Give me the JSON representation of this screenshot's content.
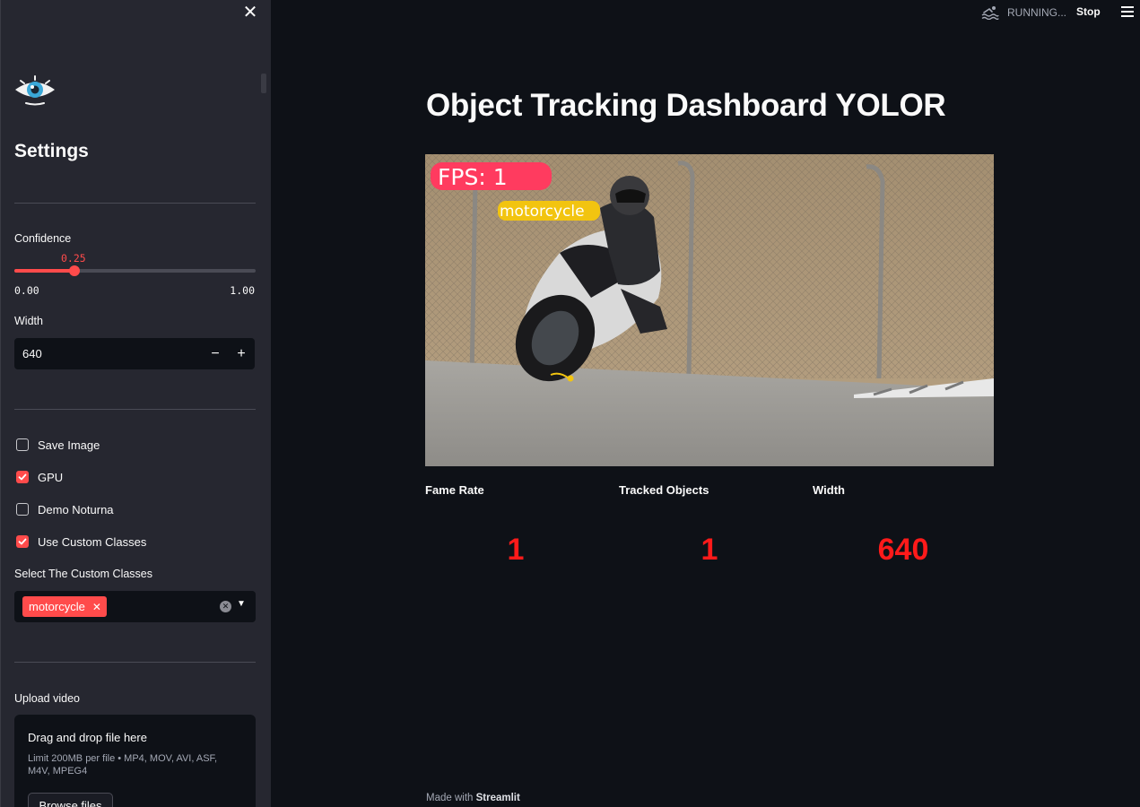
{
  "sidebar": {
    "title": "Settings",
    "confidence": {
      "label": "Confidence",
      "value": "0.25",
      "min": "0.00",
      "max": "1.00",
      "fraction": 0.25
    },
    "width_input": {
      "label": "Width",
      "value": "640",
      "minus": "−",
      "plus": "+"
    },
    "checkboxes": [
      {
        "label": "Save Image",
        "checked": false
      },
      {
        "label": "GPU",
        "checked": true
      },
      {
        "label": "Demo Noturna",
        "checked": false
      },
      {
        "label": "Use Custom Classes",
        "checked": true
      }
    ],
    "custom_classes": {
      "label": "Select The Custom Classes",
      "selected": [
        "motorcycle"
      ]
    },
    "upload": {
      "label": "Upload video",
      "drag_text": "Drag and drop file here",
      "limit_text": "Limit 200MB per file • MP4, MOV, AVI, ASF, M4V, MPEG4",
      "browse_label": "Browse files"
    }
  },
  "topbar": {
    "status": "RUNNING...",
    "stop_label": "Stop"
  },
  "main": {
    "title": "Object Tracking Dashboard YOLOR",
    "frame": {
      "fps_text": "FPS: 1",
      "detection_label": "motorcycle"
    },
    "metrics": [
      {
        "label": "Fame Rate",
        "value": "1"
      },
      {
        "label": "Tracked Objects",
        "value": "1"
      },
      {
        "label": "Width",
        "value": "640"
      }
    ]
  },
  "footer": {
    "prefix": "Made with",
    "brand": "Streamlit"
  },
  "colors": {
    "accent": "#ff4b4b",
    "metric": "#ff1a1a",
    "background": "#0e1117",
    "sidebar": "#262730"
  },
  "icons": [
    "close-icon",
    "eye-logo-icon",
    "swimmer-icon",
    "hamburger-menu-icon",
    "check-icon",
    "clear-icon",
    "chevron-down-icon"
  ]
}
